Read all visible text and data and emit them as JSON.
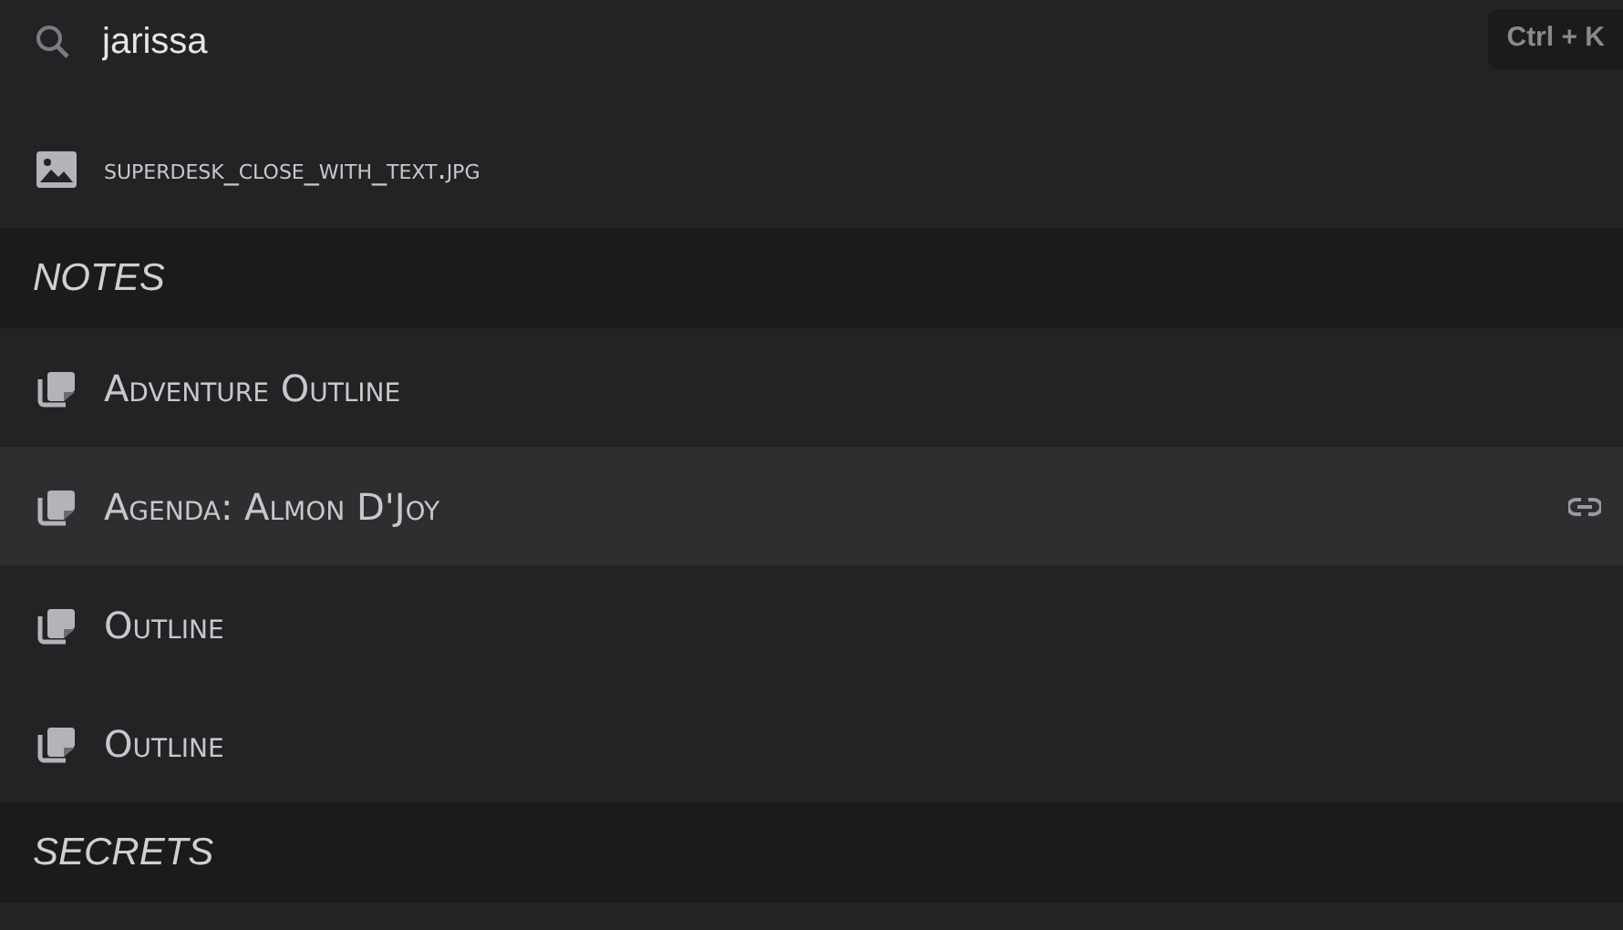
{
  "search": {
    "value": "jarissa",
    "shortcut": "Ctrl + K"
  },
  "sections": [
    {
      "items": [
        {
          "kind": "image",
          "label": "superdesk_close_with_text.jpg",
          "selected": false
        }
      ]
    },
    {
      "header": "NOTES",
      "items": [
        {
          "kind": "note",
          "label": "Adventure Outline",
          "selected": false
        },
        {
          "kind": "note",
          "label": "Agenda: Almon D'Joy",
          "selected": true
        },
        {
          "kind": "note",
          "label": "Outline",
          "selected": false
        },
        {
          "kind": "note",
          "label": "Outline",
          "selected": false
        }
      ]
    },
    {
      "header": "SECRETS"
    }
  ]
}
